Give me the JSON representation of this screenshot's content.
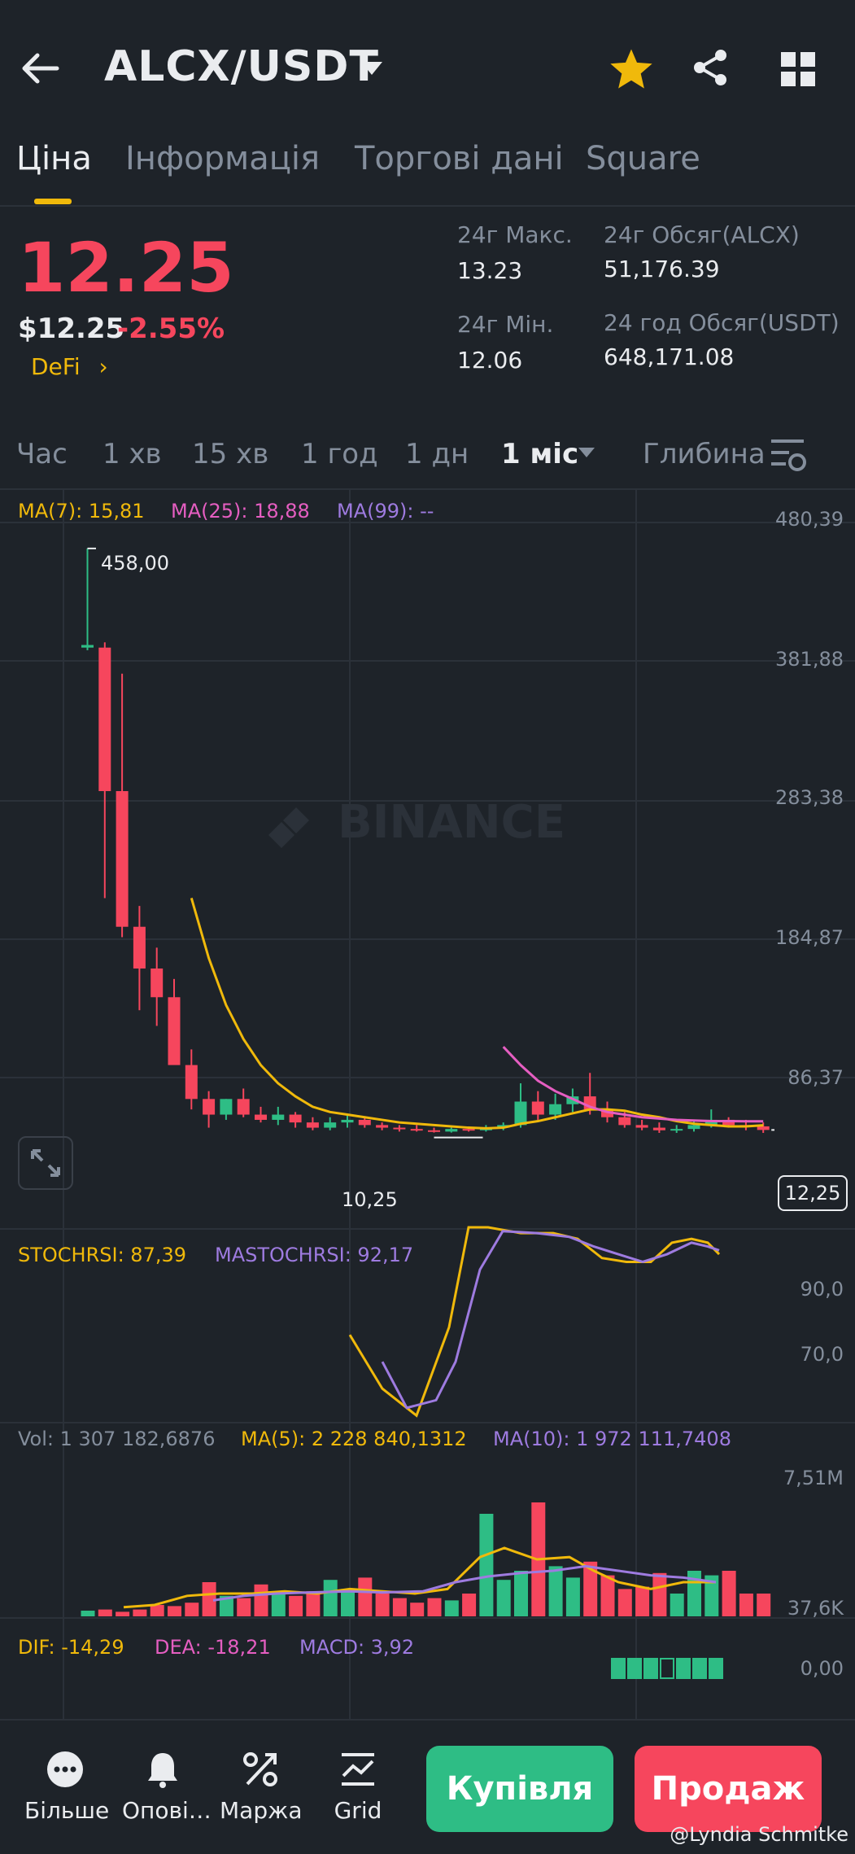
{
  "header": {
    "pair": "ALCX/USDT"
  },
  "tabs": [
    {
      "label": "Ціна",
      "active": true
    },
    {
      "label": "Інформація"
    },
    {
      "label": "Торгові дані"
    },
    {
      "label": "Square"
    }
  ],
  "price": {
    "last": "12.25",
    "usd": "$12.25",
    "change": "-2.55%",
    "category": "DeFi"
  },
  "stats": {
    "high_label": "24г Макс.",
    "high_value": "13.23",
    "low_label": "24г Мін.",
    "low_value": "12.06",
    "vol_base_label": "24г Обсяг(ALCX)",
    "vol_base_value": "51,176.39",
    "vol_quote_label": "24 год Обсяг(USDT)",
    "vol_quote_value": "648,171.08"
  },
  "intervals": [
    {
      "label": "Час"
    },
    {
      "label": "1 хв"
    },
    {
      "label": "15 хв"
    },
    {
      "label": "1 год"
    },
    {
      "label": "1 дн"
    },
    {
      "label": "1 міс",
      "active": true
    },
    {
      "label": "Глибина"
    }
  ],
  "chart_data": {
    "type": "candlestick",
    "indicators": {
      "ma7": "MA(7): 15,81",
      "ma25": "MA(25): 18,88",
      "ma99": "MA(99): --"
    },
    "y_ticks": [
      "480,39",
      "381,88",
      "283,38",
      "184,87",
      "86,37"
    ],
    "ylim": [
      0,
      480.39
    ],
    "max_label": "458,00",
    "min_label": "10,25",
    "current_price_label": "12,25",
    "watermark": "BINANCE",
    "candles": [
      {
        "o": 382,
        "h": 458,
        "l": 380,
        "c": 384
      },
      {
        "o": 382,
        "h": 386,
        "l": 190,
        "c": 272
      },
      {
        "o": 272,
        "h": 362,
        "l": 160,
        "c": 168
      },
      {
        "o": 168,
        "h": 184,
        "l": 104,
        "c": 136
      },
      {
        "o": 136,
        "h": 152,
        "l": 92,
        "c": 114
      },
      {
        "o": 114,
        "h": 128,
        "l": 70,
        "c": 62
      },
      {
        "o": 62,
        "h": 74,
        "l": 28,
        "c": 36
      },
      {
        "o": 36,
        "h": 42,
        "l": 14,
        "c": 24
      },
      {
        "o": 24,
        "h": 36,
        "l": 20,
        "c": 36
      },
      {
        "o": 36,
        "h": 44,
        "l": 22,
        "c": 24
      },
      {
        "o": 24,
        "h": 30,
        "l": 18,
        "c": 20
      },
      {
        "o": 20,
        "h": 30,
        "l": 16,
        "c": 24
      },
      {
        "o": 24,
        "h": 26,
        "l": 14,
        "c": 18
      },
      {
        "o": 18,
        "h": 22,
        "l": 12,
        "c": 14
      },
      {
        "o": 14,
        "h": 22,
        "l": 12,
        "c": 18
      },
      {
        "o": 18,
        "h": 24,
        "l": 14,
        "c": 20
      },
      {
        "o": 20,
        "h": 22,
        "l": 14,
        "c": 16
      },
      {
        "o": 16,
        "h": 18,
        "l": 12,
        "c": 14
      },
      {
        "o": 14,
        "h": 16,
        "l": 11,
        "c": 13
      },
      {
        "o": 13,
        "h": 16,
        "l": 11,
        "c": 12
      },
      {
        "o": 12,
        "h": 14,
        "l": 10.25,
        "c": 11
      },
      {
        "o": 11,
        "h": 14,
        "l": 10.25,
        "c": 13
      },
      {
        "o": 13,
        "h": 15,
        "l": 11,
        "c": 12
      },
      {
        "o": 12,
        "h": 16,
        "l": 11,
        "c": 14
      },
      {
        "o": 14,
        "h": 18,
        "l": 12,
        "c": 16
      },
      {
        "o": 16,
        "h": 48,
        "l": 14,
        "c": 34
      },
      {
        "o": 34,
        "h": 42,
        "l": 20,
        "c": 24
      },
      {
        "o": 24,
        "h": 40,
        "l": 20,
        "c": 32
      },
      {
        "o": 32,
        "h": 44,
        "l": 26,
        "c": 38
      },
      {
        "o": 38,
        "h": 56,
        "l": 24,
        "c": 28
      },
      {
        "o": 28,
        "h": 34,
        "l": 18,
        "c": 22
      },
      {
        "o": 22,
        "h": 26,
        "l": 14,
        "c": 16
      },
      {
        "o": 16,
        "h": 20,
        "l": 12,
        "c": 14
      },
      {
        "o": 14,
        "h": 18,
        "l": 10,
        "c": 12
      },
      {
        "o": 12,
        "h": 16,
        "l": 10,
        "c": 13
      },
      {
        "o": 13,
        "h": 20,
        "l": 11,
        "c": 16
      },
      {
        "o": 16,
        "h": 28,
        "l": 14,
        "c": 20
      },
      {
        "o": 20,
        "h": 22,
        "l": 14,
        "c": 16
      },
      {
        "o": 16,
        "h": 20,
        "l": 12,
        "c": 15
      },
      {
        "o": 15,
        "h": 18,
        "l": 10,
        "c": 12.25
      }
    ],
    "ma7_values": [
      null,
      null,
      null,
      null,
      null,
      null,
      190,
      144,
      108,
      82,
      62,
      48,
      38,
      30,
      26,
      24,
      22,
      20,
      18,
      17,
      16,
      15,
      14,
      13.5,
      14,
      17,
      19,
      22,
      25,
      28,
      28,
      27,
      24,
      22,
      19,
      17,
      16,
      15,
      15,
      15.81
    ],
    "ma25_values": [
      null,
      null,
      null,
      null,
      null,
      null,
      null,
      null,
      null,
      null,
      null,
      null,
      null,
      null,
      null,
      null,
      null,
      null,
      null,
      null,
      null,
      null,
      null,
      null,
      76,
      62,
      50,
      42,
      36,
      30,
      26,
      24,
      22,
      21,
      20,
      19.5,
      19,
      19,
      18.9,
      18.88
    ],
    "stochrsi": {
      "label": "STOCHRSI: 87,39",
      "ma_label": "MASTOCHRSI: 92,17",
      "ticks": [
        "90,0",
        "70,0"
      ]
    },
    "volume": {
      "label": "Vol: 1 307 182,6876",
      "ma5_label": "MA(5): 2 228 840,1312",
      "ma10_label": "MA(10): 1 972 111,7408",
      "ticks": [
        "7,51M",
        "37,6K"
      ]
    },
    "macd": {
      "dif_label": "DIF: -14,29",
      "dea_label": "DEA: -18,21",
      "macd_label": "MACD: 3,92",
      "tick": "0,00"
    }
  },
  "bottom_bar": [
    {
      "label": "Більше",
      "icon": "more-icon"
    },
    {
      "label": "Опові…",
      "icon": "bell-icon"
    },
    {
      "label": "Маржа",
      "icon": "margin-icon"
    },
    {
      "label": "Grid",
      "icon": "grid-bot-icon"
    }
  ],
  "actions": {
    "buy": "Купівля",
    "sell": "Продаж"
  },
  "credit": "@Lyndia Schmitke",
  "colors": {
    "up": "#2ebd85",
    "down": "#f6465d",
    "accent": "#f0b90b",
    "ma25": "#e55ec1",
    "ma99": "#9e7be0"
  }
}
